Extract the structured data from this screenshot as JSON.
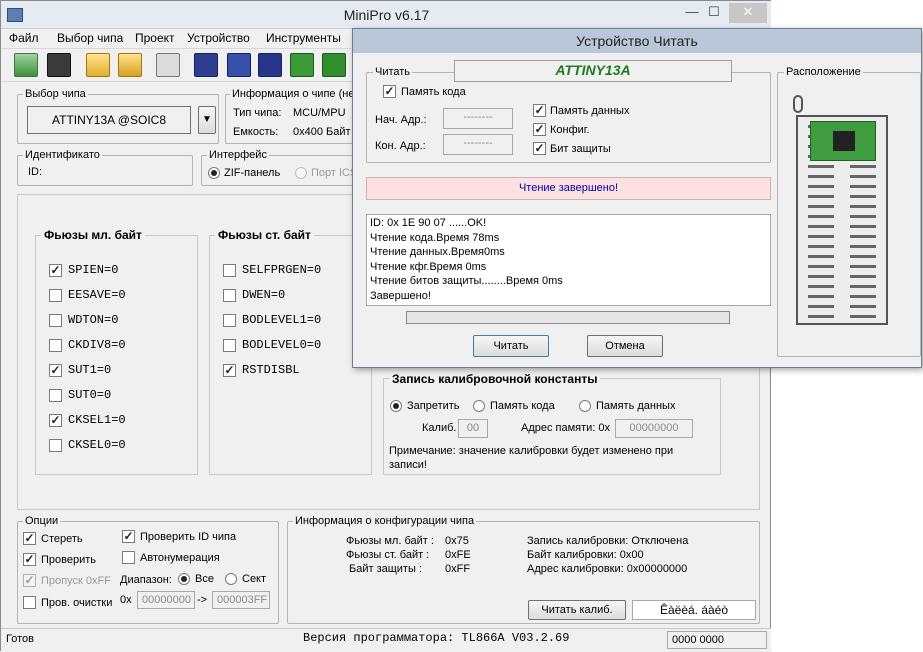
{
  "app": {
    "title": "MiniPro v6.17",
    "minimize": "—",
    "maximize": "☐",
    "close": "✕"
  },
  "menu": [
    "Файл",
    "Выбор чипа",
    "Проект",
    "Устройство",
    "Инструменты"
  ],
  "toolbar_icons": [
    "open-icon",
    "save-icon",
    "folder-icon",
    "folder-edit-icon",
    "calculator-icon",
    "chip-id-icon",
    "chip-erase-icon",
    "chip-read-icon",
    "chip-verify-icon",
    "chip-write-icon",
    "chip-protect-icon"
  ],
  "chip_select": {
    "legend": "Выбор чипа",
    "value": "ATTINY13A @SOIC8",
    "arrow": "▼"
  },
  "chip_info": {
    "legend": "Информация о чипе (не",
    "type_label": "Тип чипа:",
    "type_value": "MCU/MPU",
    "capacity_label": "Емкость:",
    "capacity_value": "0x400 Байт"
  },
  "ident": {
    "legend": "Идентификато",
    "id_label": "ID:"
  },
  "iface": {
    "legend": "Интерфейс",
    "zif": "ZIF-панель",
    "icsp": "Порт ICS"
  },
  "fuses_low": {
    "title": "Фьюзы мл. байт",
    "items": [
      {
        "name": "SPIEN=0",
        "checked": true
      },
      {
        "name": "EESAVE=0",
        "checked": false
      },
      {
        "name": "WDTON=0",
        "checked": false
      },
      {
        "name": "CKDIV8=0",
        "checked": false
      },
      {
        "name": "SUT1=0",
        "checked": true
      },
      {
        "name": "SUT0=0",
        "checked": false
      },
      {
        "name": "CKSEL1=0",
        "checked": true
      },
      {
        "name": "CKSEL0=0",
        "checked": false
      }
    ]
  },
  "fuses_high": {
    "title": "Фьюзы ст. байт",
    "items": [
      {
        "name": "SELFPRGEN=0",
        "checked": false
      },
      {
        "name": "DWEN=0",
        "checked": false
      },
      {
        "name": "BODLEVEL1=0",
        "checked": false
      },
      {
        "name": "BODLEVEL0=0",
        "checked": false
      },
      {
        "name": "RSTDISBL",
        "checked": true
      }
    ]
  },
  "calib": {
    "title": "Запись калибровочной константы",
    "r1": "Запретить",
    "r2": "Память кода",
    "r3": "Память данных",
    "calib_label": "Калиб.",
    "calib_value": "00",
    "addr_label": "Адрес памяти: 0x",
    "addr_value": "00000000",
    "note1": "Примечание: значение калибровки будет изменено при",
    "note2": "записи!"
  },
  "options": {
    "legend": "Опции",
    "erase": "Стереть",
    "verify": "Проверить",
    "skip": "Пропуск 0xFF",
    "blank": "Пров. очистки",
    "check_id": "Проверить ID чипа",
    "autonum": "Автонумерация",
    "range": "Диапазон:",
    "all": "Все",
    "sector": "Сект",
    "from_label": "0x",
    "from": "00000000",
    "arrow": "->",
    "to": "000003FF"
  },
  "config_info": {
    "legend": "Информация о конфигурации чипа",
    "low_label": "Фьюзы мл. байт :",
    "low_value": "0x75",
    "high_label": "Фьюзы ст. байт :",
    "high_value": "0xFE",
    "lock_label": "Байт защиты :",
    "lock_value": "0xFF",
    "cal_write": "Запись калибровки: Отключена",
    "cal_byte": "Байт калибровки:   0x00",
    "cal_addr": "Адрес калибровки: 0x00000000",
    "read_cal_btn": "Читать калиб.",
    "cal_field": "Êàëèá. áàéò"
  },
  "status": {
    "ready": "Готов",
    "version": "Версия программатора: TL866A V03.2.69",
    "counter": "0000 0000"
  },
  "dialog": {
    "title": "Устройство Читать",
    "read_legend": "Читать",
    "device": "ATTINY13A",
    "code_mem": "Память кода",
    "start_label": "Нач. Адр.:",
    "end_label": "Кон. Адр.:",
    "start_value": "--------",
    "end_value": "--------",
    "data_mem": "Память данных",
    "config": "Конфиг.",
    "lock": "Бит защиты",
    "status_msg": "Чтение завершено!",
    "log": [
      "ID: 0x 1E 90 07 ......OK!",
      "Чтение кода.Время 78ms",
      "Чтение данных.Время0ms",
      "Чтение кфг.Время 0ms",
      "Чтение битов защиты........Время 0ms",
      "Завершено!"
    ],
    "progress": 0,
    "read_btn": "Читать",
    "cancel_btn": "Отмена",
    "placement_legend": "Расположение"
  },
  "colors": {
    "accent": "#1f7a1f",
    "status_bg": "#fde1e1",
    "status_text": "#0000aa",
    "pcb": "#3f9c3f"
  }
}
